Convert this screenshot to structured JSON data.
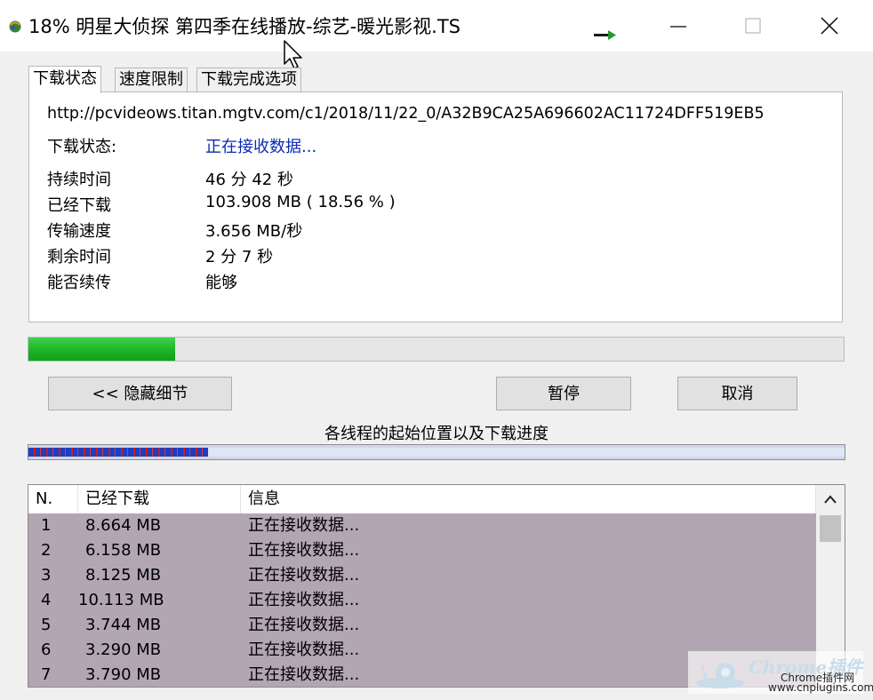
{
  "window": {
    "title": "18% 明星大侦探 第四季在线播放-综艺-暖光影视.TS"
  },
  "tabs": [
    {
      "label": "下载状态",
      "active": true
    },
    {
      "label": "速度限制",
      "active": false
    },
    {
      "label": "下载完成选项",
      "active": false
    }
  ],
  "details": {
    "url": "http://pcvideows.titan.mgtv.com/c1/2018/11/22_0/A32B9CA25A696602AC11724DFF519EB5",
    "status_label": "下载状态:",
    "status_value": "正在接收数据...",
    "rows": [
      {
        "label": "持续时间",
        "value": "46 分 42 秒"
      },
      {
        "label": "已经下载",
        "value": "103.908  MB ( 18.56 % )"
      },
      {
        "label": "传输速度",
        "value": "3.656  MB/秒"
      },
      {
        "label": "剩余时间",
        "value": "2 分 7 秒"
      },
      {
        "label": "能否续传",
        "value": "能够"
      }
    ]
  },
  "progress": {
    "percent": 18
  },
  "buttons": {
    "hide_details": "<< 隐藏细节",
    "pause": "暂停",
    "cancel": "取消"
  },
  "threads": {
    "caption": "各线程的起始位置以及下载进度"
  },
  "list": {
    "columns": [
      "N.",
      "已经下载",
      "信息"
    ],
    "rows": [
      {
        "n": "1",
        "size": "8.664  MB",
        "info": "正在接收数据..."
      },
      {
        "n": "2",
        "size": "6.158  MB",
        "info": "正在接收数据..."
      },
      {
        "n": "3",
        "size": "8.125  MB",
        "info": "正在接收数据..."
      },
      {
        "n": "4",
        "size": "10.113  MB",
        "info": "正在接收数据..."
      },
      {
        "n": "5",
        "size": "3.744  MB",
        "info": "正在接收数据..."
      },
      {
        "n": "6",
        "size": "3.290  MB",
        "info": "正在接收数据..."
      },
      {
        "n": "7",
        "size": "3.790  MB",
        "info": "正在接收数据..."
      }
    ]
  },
  "watermark": {
    "brand": "Chrome插件",
    "subtitle": "Chrome插件网",
    "url": "www.cnplugins.com"
  },
  "colors": {
    "progress_green": "#1fb628",
    "status_blue": "#0b2cb5",
    "list_row_bg": "#b3a6b3"
  }
}
